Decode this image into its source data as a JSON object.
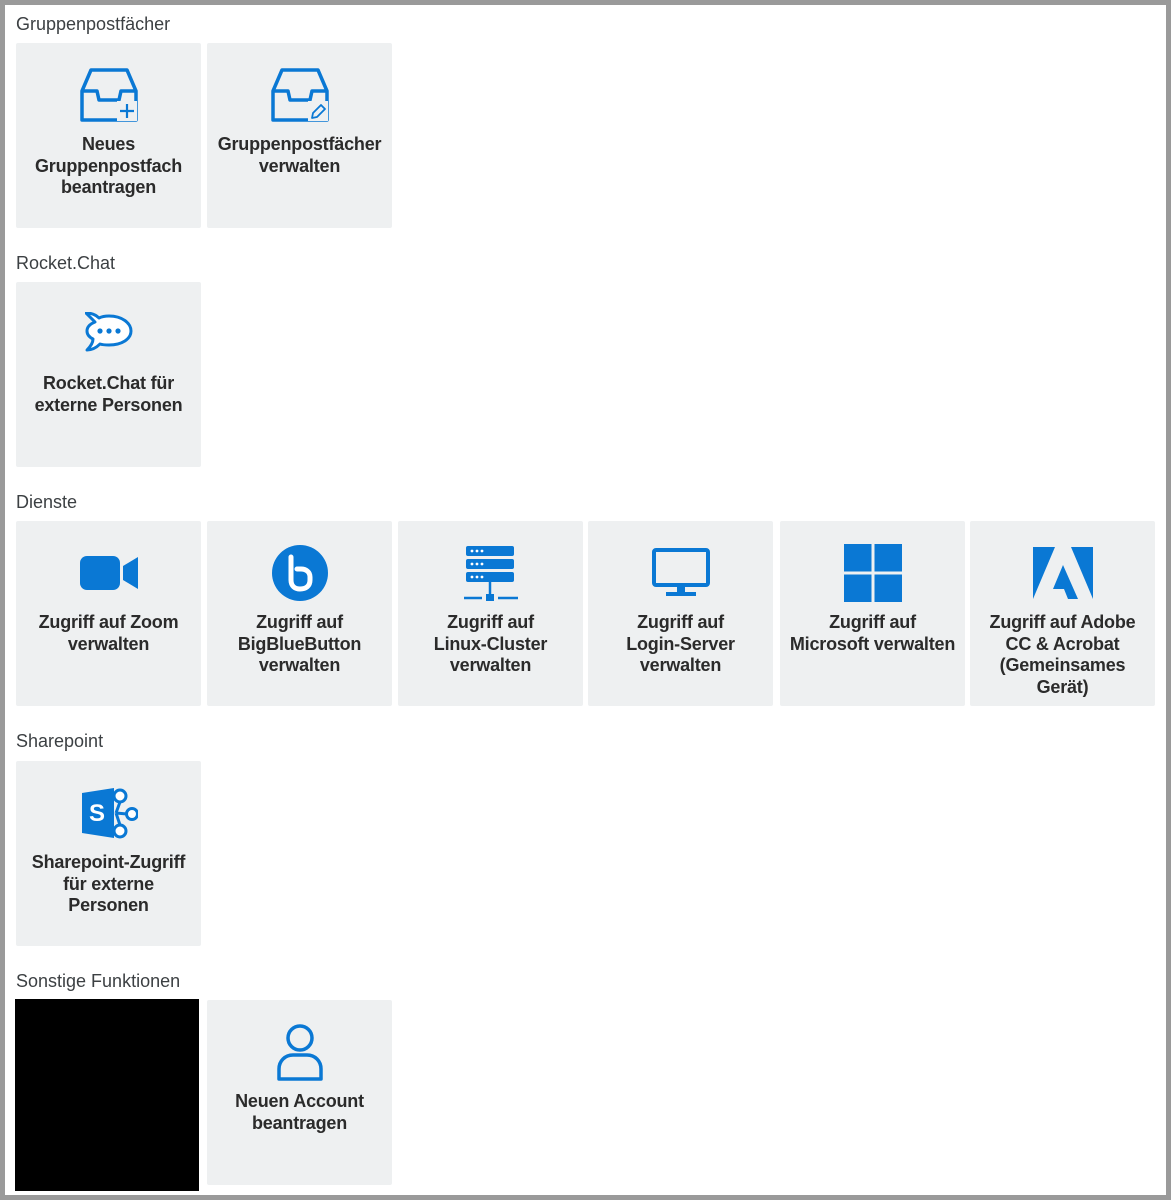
{
  "accent_color": "#0a78d4",
  "sections": [
    {
      "title": "Gruppenpostfächer",
      "tiles": [
        {
          "icon": "inbox-add-icon",
          "label": "Neues\nGruppenpostfach\nbeantragen"
        },
        {
          "icon": "inbox-edit-icon",
          "label": "Gruppenpostfächer\nverwalten"
        }
      ]
    },
    {
      "title": "Rocket.Chat",
      "tiles": [
        {
          "icon": "rocketchat-icon",
          "label": "Rocket.Chat für\nexterne Personen"
        }
      ]
    },
    {
      "title": "Dienste",
      "tiles": [
        {
          "icon": "zoom-camera-icon",
          "label": "Zugriff auf Zoom\nverwalten"
        },
        {
          "icon": "bigbluebutton-icon",
          "label": "Zugriff auf\nBigBlueButton\nverwalten"
        },
        {
          "icon": "server-icon",
          "label": "Zugriff auf\nLinux-Cluster\nverwalten"
        },
        {
          "icon": "monitor-icon",
          "label": "Zugriff auf\nLogin-Server\nverwalten"
        },
        {
          "icon": "windows-icon",
          "label": "Zugriff auf\nMicrosoft verwalten"
        },
        {
          "icon": "adobe-icon",
          "label": "Zugriff auf Adobe\nCC & Acrobat\n(Gemeinsames\nGerät)"
        }
      ]
    },
    {
      "title": "Sharepoint",
      "tiles": [
        {
          "icon": "sharepoint-icon",
          "label": "Sharepoint-Zugriff\nfür externe\nPersonen"
        }
      ]
    },
    {
      "title": "Sonstige Funktionen",
      "tiles": [
        {
          "icon": "user-icon",
          "label": "Neuen Account\nbeantragen"
        }
      ]
    }
  ]
}
